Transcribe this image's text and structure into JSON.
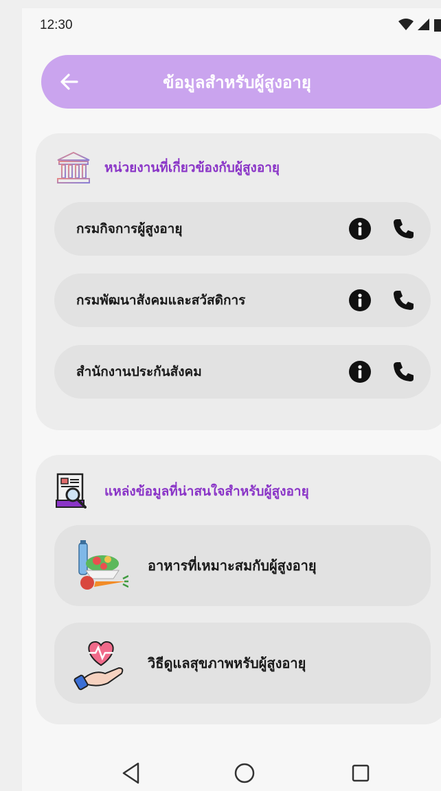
{
  "status_bar": {
    "time": "12:30",
    "icons": [
      "wifi-icon",
      "signal-icon",
      "battery-icon"
    ]
  },
  "app_bar": {
    "back_icon": "arrow-left-icon",
    "title": "ข้อมูลสำหรับผู้สูงอายุ",
    "color": "#caa4ee"
  },
  "agencies": {
    "title": "หน่วยงานที่เกี่ยวข้องกับผู้สูงอายุ",
    "icon": "government-building-icon",
    "items": [
      {
        "label": "กรมกิจการผู้สูงอายุ",
        "info_icon": "info-icon",
        "phone_icon": "phone-icon"
      },
      {
        "label": "กรมพัฒนาสังคมและสวัสดิการ",
        "info_icon": "info-icon",
        "phone_icon": "phone-icon"
      },
      {
        "label": "สำนักงานประกันสังคม",
        "info_icon": "info-icon",
        "phone_icon": "phone-icon"
      }
    ]
  },
  "resources": {
    "title": "แหล่งข้อมูลที่น่าสนใจสำหรับผู้สูงอายุ",
    "icon": "document-search-icon",
    "items": [
      {
        "label": "อาหารที่เหมาะสมกับผู้สูงอายุ",
        "icon": "healthy-food-icon"
      },
      {
        "label": "วิธีดูแลสุขภาพหรับผู้สูงอายุ",
        "icon": "heart-in-hand-icon"
      }
    ]
  },
  "accent_color": "#8a35c7",
  "nav_bar": {
    "buttons": [
      "back-triangle-icon",
      "home-circle-icon",
      "recents-square-icon"
    ]
  }
}
